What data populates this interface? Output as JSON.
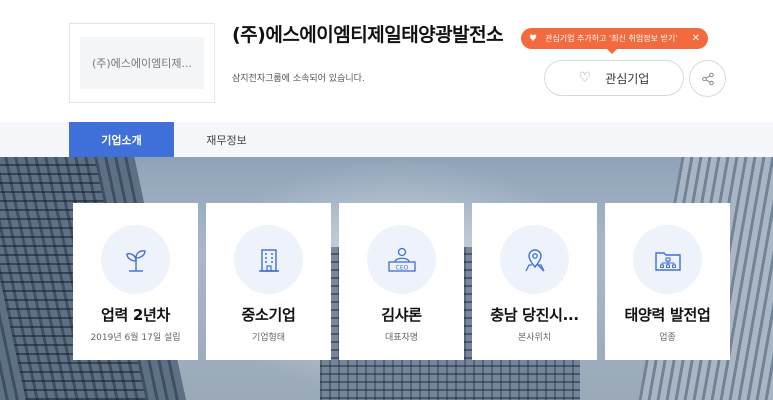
{
  "company": {
    "logo_text": "(주)에스에이엠티제...",
    "name": "(주)에스에이엠티제일태양광발전소",
    "subtitle": "삼지전자그룹에 소속되어 있습니다."
  },
  "tooltip": {
    "text": "관심기업 추가하고 '최신 취업정보 받기'",
    "heart_icon": "heart-icon",
    "close_glyph": "✕"
  },
  "actions": {
    "favorite_label": "관심기업",
    "share_icon": "share-icon"
  },
  "tabs": [
    {
      "label": "기업소개",
      "active": true
    },
    {
      "label": "재무정보",
      "active": false
    }
  ],
  "cards": [
    {
      "value": "업력 2년차",
      "label": "2019년 6월 17일 설립",
      "icon": "sprout-icon"
    },
    {
      "value": "중소기업",
      "label": "기업형태",
      "icon": "building-icon"
    },
    {
      "value": "김샤론",
      "label": "대표자명",
      "icon": "ceo-icon",
      "icon_text": "CEO"
    },
    {
      "value": "충남 당진시...",
      "label": "본사위치",
      "icon": "map-pin-icon"
    },
    {
      "value": "태양력 발전업",
      "label": "업종",
      "icon": "folder-org-icon"
    }
  ],
  "colors": {
    "accent": "#3f6fd8",
    "tooltip": "#f26a3d",
    "icon_blue": "#3f6fd8"
  }
}
